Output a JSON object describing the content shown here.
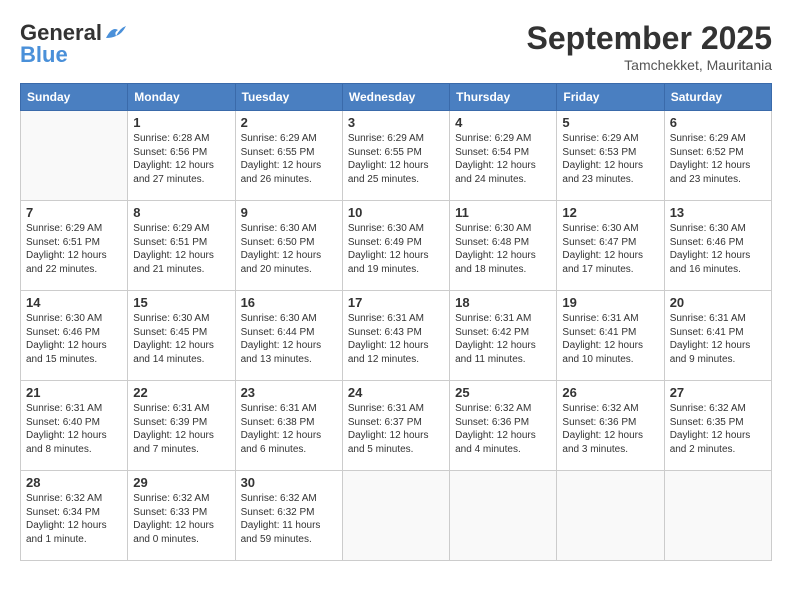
{
  "header": {
    "logo_line1": "General",
    "logo_line2": "Blue",
    "month": "September 2025",
    "location": "Tamchekket, Mauritania"
  },
  "weekdays": [
    "Sunday",
    "Monday",
    "Tuesday",
    "Wednesday",
    "Thursday",
    "Friday",
    "Saturday"
  ],
  "weeks": [
    [
      {
        "day": "",
        "info": ""
      },
      {
        "day": "1",
        "info": "Sunrise: 6:28 AM\nSunset: 6:56 PM\nDaylight: 12 hours and 27 minutes."
      },
      {
        "day": "2",
        "info": "Sunrise: 6:29 AM\nSunset: 6:55 PM\nDaylight: 12 hours and 26 minutes."
      },
      {
        "day": "3",
        "info": "Sunrise: 6:29 AM\nSunset: 6:55 PM\nDaylight: 12 hours and 25 minutes."
      },
      {
        "day": "4",
        "info": "Sunrise: 6:29 AM\nSunset: 6:54 PM\nDaylight: 12 hours and 24 minutes."
      },
      {
        "day": "5",
        "info": "Sunrise: 6:29 AM\nSunset: 6:53 PM\nDaylight: 12 hours and 23 minutes."
      },
      {
        "day": "6",
        "info": "Sunrise: 6:29 AM\nSunset: 6:52 PM\nDaylight: 12 hours and 23 minutes."
      }
    ],
    [
      {
        "day": "7",
        "info": "Sunrise: 6:29 AM\nSunset: 6:51 PM\nDaylight: 12 hours and 22 minutes."
      },
      {
        "day": "8",
        "info": "Sunrise: 6:29 AM\nSunset: 6:51 PM\nDaylight: 12 hours and 21 minutes."
      },
      {
        "day": "9",
        "info": "Sunrise: 6:30 AM\nSunset: 6:50 PM\nDaylight: 12 hours and 20 minutes."
      },
      {
        "day": "10",
        "info": "Sunrise: 6:30 AM\nSunset: 6:49 PM\nDaylight: 12 hours and 19 minutes."
      },
      {
        "day": "11",
        "info": "Sunrise: 6:30 AM\nSunset: 6:48 PM\nDaylight: 12 hours and 18 minutes."
      },
      {
        "day": "12",
        "info": "Sunrise: 6:30 AM\nSunset: 6:47 PM\nDaylight: 12 hours and 17 minutes."
      },
      {
        "day": "13",
        "info": "Sunrise: 6:30 AM\nSunset: 6:46 PM\nDaylight: 12 hours and 16 minutes."
      }
    ],
    [
      {
        "day": "14",
        "info": "Sunrise: 6:30 AM\nSunset: 6:46 PM\nDaylight: 12 hours and 15 minutes."
      },
      {
        "day": "15",
        "info": "Sunrise: 6:30 AM\nSunset: 6:45 PM\nDaylight: 12 hours and 14 minutes."
      },
      {
        "day": "16",
        "info": "Sunrise: 6:30 AM\nSunset: 6:44 PM\nDaylight: 12 hours and 13 minutes."
      },
      {
        "day": "17",
        "info": "Sunrise: 6:31 AM\nSunset: 6:43 PM\nDaylight: 12 hours and 12 minutes."
      },
      {
        "day": "18",
        "info": "Sunrise: 6:31 AM\nSunset: 6:42 PM\nDaylight: 12 hours and 11 minutes."
      },
      {
        "day": "19",
        "info": "Sunrise: 6:31 AM\nSunset: 6:41 PM\nDaylight: 12 hours and 10 minutes."
      },
      {
        "day": "20",
        "info": "Sunrise: 6:31 AM\nSunset: 6:41 PM\nDaylight: 12 hours and 9 minutes."
      }
    ],
    [
      {
        "day": "21",
        "info": "Sunrise: 6:31 AM\nSunset: 6:40 PM\nDaylight: 12 hours and 8 minutes."
      },
      {
        "day": "22",
        "info": "Sunrise: 6:31 AM\nSunset: 6:39 PM\nDaylight: 12 hours and 7 minutes."
      },
      {
        "day": "23",
        "info": "Sunrise: 6:31 AM\nSunset: 6:38 PM\nDaylight: 12 hours and 6 minutes."
      },
      {
        "day": "24",
        "info": "Sunrise: 6:31 AM\nSunset: 6:37 PM\nDaylight: 12 hours and 5 minutes."
      },
      {
        "day": "25",
        "info": "Sunrise: 6:32 AM\nSunset: 6:36 PM\nDaylight: 12 hours and 4 minutes."
      },
      {
        "day": "26",
        "info": "Sunrise: 6:32 AM\nSunset: 6:36 PM\nDaylight: 12 hours and 3 minutes."
      },
      {
        "day": "27",
        "info": "Sunrise: 6:32 AM\nSunset: 6:35 PM\nDaylight: 12 hours and 2 minutes."
      }
    ],
    [
      {
        "day": "28",
        "info": "Sunrise: 6:32 AM\nSunset: 6:34 PM\nDaylight: 12 hours and 1 minute."
      },
      {
        "day": "29",
        "info": "Sunrise: 6:32 AM\nSunset: 6:33 PM\nDaylight: 12 hours and 0 minutes."
      },
      {
        "day": "30",
        "info": "Sunrise: 6:32 AM\nSunset: 6:32 PM\nDaylight: 11 hours and 59 minutes."
      },
      {
        "day": "",
        "info": ""
      },
      {
        "day": "",
        "info": ""
      },
      {
        "day": "",
        "info": ""
      },
      {
        "day": "",
        "info": ""
      }
    ]
  ]
}
